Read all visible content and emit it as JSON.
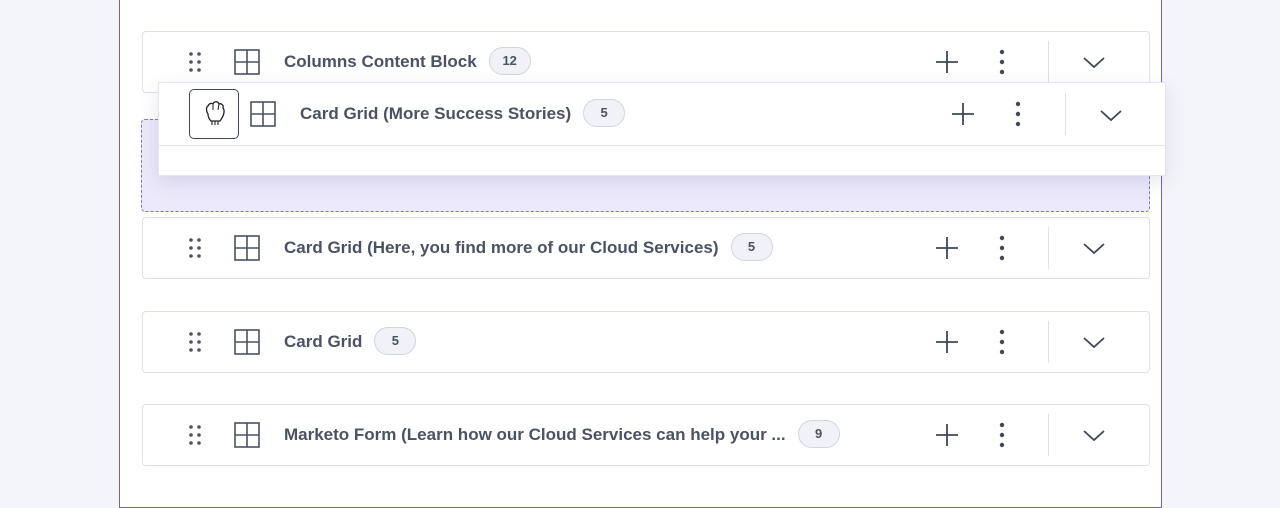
{
  "blocks": [
    {
      "title": "Columns Content Block",
      "count": "12"
    },
    {
      "title": "Card Grid (Here, you find more of our Cloud Services)",
      "count": "5"
    },
    {
      "title": "Card Grid",
      "count": "5"
    },
    {
      "title": "Marketo Form (Learn how our Cloud Services can help your ...",
      "count": "9"
    }
  ],
  "dragging": {
    "title": "Card Grid (More Success Stories)",
    "count": "5"
  },
  "icons": {
    "drag": "drag-handle-icon",
    "block": "grid-block-icon",
    "add": "plus-icon",
    "more": "more-vertical-icon",
    "expand": "chevron-down-icon",
    "cursor": "grab-hand-icon"
  },
  "colors": {
    "accent": "#6b63d9",
    "drop_zone": "#ece9fb"
  }
}
